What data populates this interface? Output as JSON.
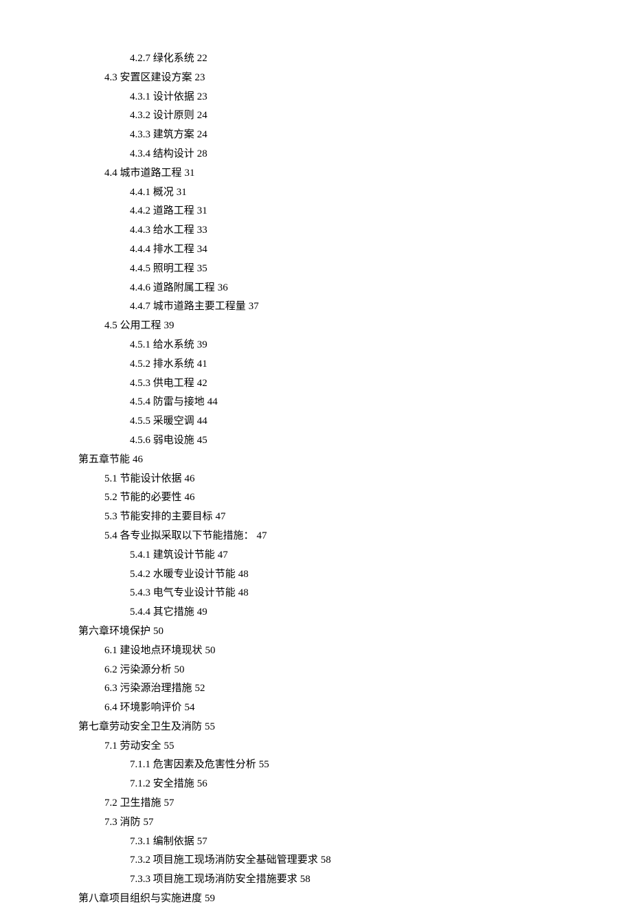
{
  "toc": [
    {
      "indent": 2,
      "num": "4.2.7",
      "title": "绿化系统",
      "page": "22"
    },
    {
      "indent": 1,
      "num": "4.3",
      "title": "安置区建设方案",
      "page": "23"
    },
    {
      "indent": 2,
      "num": "4.3.1",
      "title": "设计依据",
      "page": "23"
    },
    {
      "indent": 2,
      "num": "4.3.2",
      "title": "设计原则",
      "page": "24"
    },
    {
      "indent": 2,
      "num": "4.3.3",
      "title": "建筑方案",
      "page": "24"
    },
    {
      "indent": 2,
      "num": "4.3.4",
      "title": "结构设计",
      "page": "28"
    },
    {
      "indent": 1,
      "num": "4.4",
      "title": "城市道路工程",
      "page": "31"
    },
    {
      "indent": 2,
      "num": "4.4.1",
      "title": "概况",
      "page": "31"
    },
    {
      "indent": 2,
      "num": "4.4.2",
      "title": "道路工程",
      "page": "31"
    },
    {
      "indent": 2,
      "num": "4.4.3",
      "title": "给水工程",
      "page": "33"
    },
    {
      "indent": 2,
      "num": "4.4.4",
      "title": "排水工程",
      "page": "34"
    },
    {
      "indent": 2,
      "num": "4.4.5",
      "title": "照明工程",
      "page": "35"
    },
    {
      "indent": 2,
      "num": "4.4.6",
      "title": "道路附属工程",
      "page": "36"
    },
    {
      "indent": 2,
      "num": "4.4.7",
      "title": "城市道路主要工程量",
      "page": "37"
    },
    {
      "indent": 1,
      "num": "4.5",
      "title": "公用工程",
      "page": "39"
    },
    {
      "indent": 2,
      "num": "4.5.1",
      "title": "给水系统",
      "page": "39"
    },
    {
      "indent": 2,
      "num": "4.5.2",
      "title": "排水系统",
      "page": "41"
    },
    {
      "indent": 2,
      "num": "4.5.3",
      "title": "供电工程",
      "page": "42"
    },
    {
      "indent": 2,
      "num": "4.5.4",
      "title": "防雷与接地",
      "page": "44"
    },
    {
      "indent": 2,
      "num": "4.5.5",
      "title": "采暖空调",
      "page": "44"
    },
    {
      "indent": 2,
      "num": "4.5.6",
      "title": "弱电设施",
      "page": "45"
    },
    {
      "indent": 0,
      "num": "第五章",
      "title": "节能",
      "page": "46",
      "nospace": true
    },
    {
      "indent": 1,
      "num": "5.1",
      "title": "节能设计依据",
      "page": "46"
    },
    {
      "indent": 1,
      "num": "5.2",
      "title": "节能的必要性",
      "page": "46"
    },
    {
      "indent": 1,
      "num": "5.3",
      "title": "节能安排的主要目标",
      "page": "47"
    },
    {
      "indent": 1,
      "num": "5.4",
      "title": "各专业拟采取以下节能措施：",
      "page": "47"
    },
    {
      "indent": 2,
      "num": "5.4.1",
      "title": "建筑设计节能",
      "page": "47"
    },
    {
      "indent": 2,
      "num": "5.4.2",
      "title": "水暖专业设计节能",
      "page": "48"
    },
    {
      "indent": 2,
      "num": "5.4.3",
      "title": "电气专业设计节能",
      "page": "48"
    },
    {
      "indent": 2,
      "num": "5.4.4",
      "title": "其它措施",
      "page": "49"
    },
    {
      "indent": 0,
      "num": "第六章",
      "title": "环境保护",
      "page": "50",
      "nospace": true
    },
    {
      "indent": 1,
      "num": "6.1",
      "title": "建设地点环境现状",
      "page": "50"
    },
    {
      "indent": 1,
      "num": "6.2",
      "title": "污染源分析",
      "page": "50"
    },
    {
      "indent": 1,
      "num": "6.3",
      "title": "污染源治理措施",
      "page": "52"
    },
    {
      "indent": 1,
      "num": "6.4",
      "title": "环境影响评价",
      "page": "54"
    },
    {
      "indent": 0,
      "num": "第七章",
      "title": "劳动安全卫生及消防",
      "page": "55",
      "nospace": true
    },
    {
      "indent": 1,
      "num": "7.1",
      "title": "劳动安全",
      "page": "55"
    },
    {
      "indent": 2,
      "num": "7.1.1",
      "title": "危害因素及危害性分析",
      "page": "55"
    },
    {
      "indent": 2,
      "num": "7.1.2",
      "title": "安全措施",
      "page": "56"
    },
    {
      "indent": 1,
      "num": "7.2",
      "title": "卫生措施",
      "page": "57"
    },
    {
      "indent": 1,
      "num": "7.3",
      "title": "消防",
      "page": "57"
    },
    {
      "indent": 2,
      "num": "7.3.1",
      "title": "编制依据",
      "page": "57"
    },
    {
      "indent": 2,
      "num": "7.3.2",
      "title": "项目施工现场消防安全基础管理要求",
      "page": "58"
    },
    {
      "indent": 2,
      "num": "7.3.3",
      "title": "项目施工现场消防安全措施要求",
      "page": "58"
    },
    {
      "indent": 0,
      "num": "第八章",
      "title": "项目组织与实施进度",
      "page": "59",
      "nospace": true
    }
  ]
}
